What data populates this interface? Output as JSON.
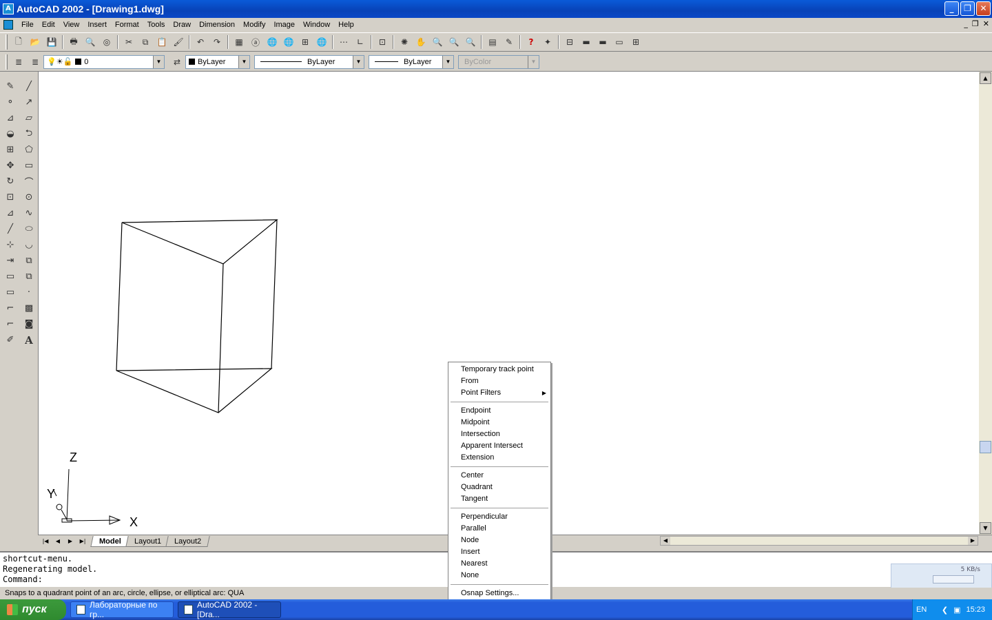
{
  "window": {
    "title": "AutoCAD 2002 - [Drawing1.dwg]",
    "app_icon": "autocad-icon"
  },
  "menubar": {
    "items": [
      "File",
      "Edit",
      "View",
      "Insert",
      "Format",
      "Tools",
      "Draw",
      "Dimension",
      "Modify",
      "Image",
      "Window",
      "Help"
    ]
  },
  "properties": {
    "layer": "0",
    "color": "ByLayer",
    "linetype": "ByLayer",
    "lineweight": "ByLayer",
    "plotstyle": "ByColor"
  },
  "canvas": {
    "ucs": {
      "x_label": "X",
      "y_label": "Y",
      "z_label": "Z"
    }
  },
  "layout_tabs": {
    "tabs": [
      "Model",
      "Layout1",
      "Layout2"
    ],
    "active": "Model"
  },
  "context_menu": {
    "groups": [
      [
        {
          "label": "Temporary track point"
        },
        {
          "label": "From"
        },
        {
          "label": "Point Filters",
          "submenu": true
        }
      ],
      [
        {
          "label": "Endpoint"
        },
        {
          "label": "Midpoint"
        },
        {
          "label": "Intersection"
        },
        {
          "label": "Apparent Intersect"
        },
        {
          "label": "Extension"
        }
      ],
      [
        {
          "label": "Center"
        },
        {
          "label": "Quadrant"
        },
        {
          "label": "Tangent"
        }
      ],
      [
        {
          "label": "Perpendicular"
        },
        {
          "label": "Parallel"
        },
        {
          "label": "Node"
        },
        {
          "label": "Insert"
        },
        {
          "label": "Nearest"
        },
        {
          "label": "None"
        }
      ],
      [
        {
          "label": "Osnap Settings..."
        }
      ]
    ]
  },
  "command_line": {
    "lines": [
      "shortcut-menu.",
      "Regenerating model.",
      "Command:"
    ]
  },
  "status_bar": {
    "text": "Snaps to a quadrant point of an arc, circle, ellipse, or elliptical arc:  QUA"
  },
  "net_widget": {
    "rate": "5 KB/s"
  },
  "taskbar": {
    "start_label": "пуск",
    "tasks": [
      {
        "label": "Лабораторные по гр...",
        "active": false
      },
      {
        "label": "AutoCAD 2002 - [Dra...",
        "active": true
      }
    ],
    "language": "EN",
    "clock": "15:23"
  }
}
